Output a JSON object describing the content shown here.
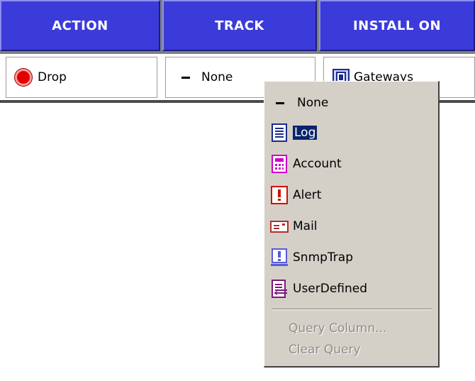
{
  "columns": {
    "action": "ACTION",
    "track": "TRACK",
    "install_on": "INSTALL ON"
  },
  "row": {
    "action": {
      "label": "Drop",
      "icon": "drop-icon"
    },
    "track": {
      "label": "None",
      "icon": "dash-icon"
    },
    "install_on": {
      "label": "Gateways",
      "icon": "gateway-icon"
    }
  },
  "context_menu": {
    "items": [
      {
        "label": "None",
        "icon": "dash-icon",
        "color": "#000000"
      },
      {
        "label": "Log",
        "icon": "log-icon",
        "color": "#1a2a8c",
        "selected": true
      },
      {
        "label": "Account",
        "icon": "account-icon",
        "color": "#cc00cc"
      },
      {
        "label": "Alert",
        "icon": "alert-icon",
        "color": "#cc1100"
      },
      {
        "label": "Mail",
        "icon": "mail-icon",
        "color": "#b03030"
      },
      {
        "label": "SnmpTrap",
        "icon": "snmp-trap-icon",
        "color": "#5a5ad8"
      },
      {
        "label": "UserDefined",
        "icon": "user-defined-icon",
        "color": "#7a1a7a"
      }
    ],
    "disabled_items": [
      {
        "label": "Query Column..."
      },
      {
        "label": "Clear Query"
      }
    ]
  },
  "colors": {
    "header_bg": "#3b3bd9",
    "header_text": "#ffffff",
    "menu_bg": "#d4d0c8",
    "selection_bg": "#0a246a",
    "disabled_text": "#8f8c86"
  }
}
